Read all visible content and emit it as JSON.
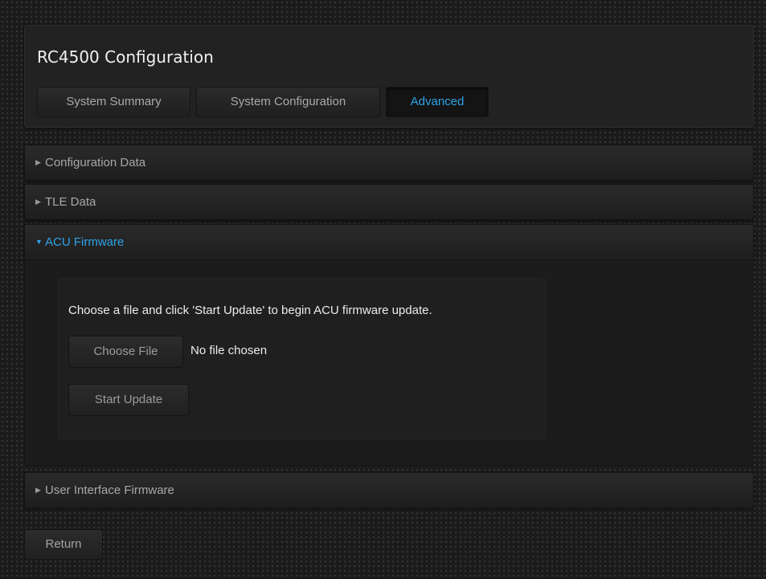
{
  "header": {
    "title": "RC4500 Configuration",
    "tabs": [
      {
        "label": "System Summary",
        "active": false
      },
      {
        "label": "System Configuration",
        "active": false
      },
      {
        "label": "Advanced",
        "active": true
      }
    ]
  },
  "accordion": {
    "sections": [
      {
        "label": "Configuration Data",
        "expanded": false,
        "icon": "caret-right-icon"
      },
      {
        "label": "TLE Data",
        "expanded": false,
        "icon": "caret-right-icon"
      },
      {
        "label": "ACU Firmware",
        "expanded": true,
        "icon": "caret-down-icon"
      },
      {
        "label": "User Interface Firmware",
        "expanded": false,
        "icon": "caret-right-icon"
      }
    ]
  },
  "firmware_update": {
    "instructions": "Choose a file and click 'Start Update' to begin ACU firmware update.",
    "choose_file_label": "Choose File",
    "file_status": "No file chosen",
    "start_update_label": "Start Update"
  },
  "footer": {
    "return_label": "Return"
  },
  "colors": {
    "accent": "#2ea3e8",
    "background": "#1b1b1b",
    "panel": "#222222",
    "text_light": "#ececec",
    "text_muted": "#a8a8a8"
  }
}
